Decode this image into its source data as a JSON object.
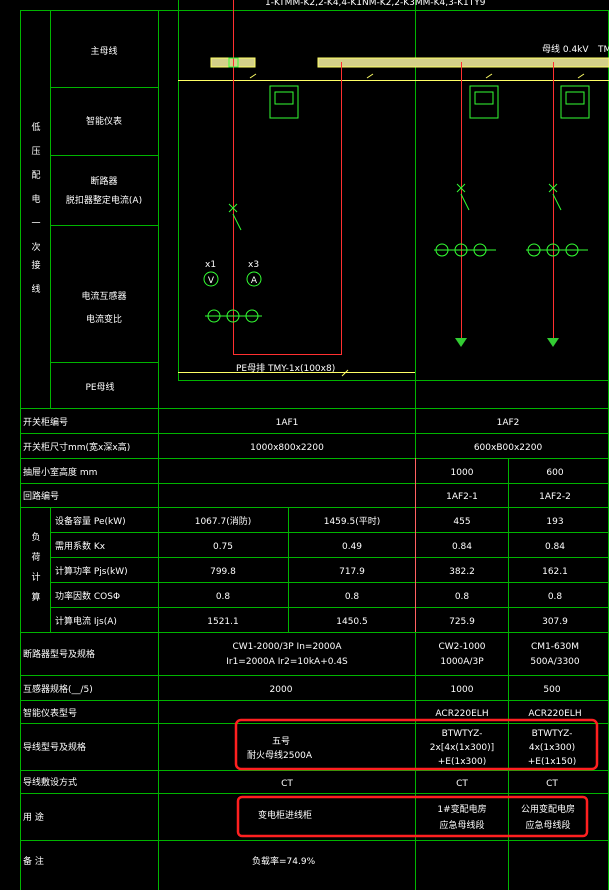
{
  "title_top": "1-KTMM-K2,2-K4,4-K1NM-K2,2-K3MM-K4,3-K1TY9",
  "bus_label": "母线 0.4kV",
  "bus_label_right": "TM",
  "left_headings": {
    "main_section_chars": [
      "低",
      "压",
      "配",
      "电",
      "一",
      "次",
      "接",
      "线"
    ],
    "main_busbar": "主母线",
    "smart_meter": "智能仪表",
    "breaker_line1": "断路器",
    "breaker_line2": "脱扣器整定电流(A)",
    "ct_line1": "电流互感器",
    "ct_line2": "电流变比",
    "pe_busbar": "PE母线"
  },
  "meters": {
    "v_label": "x1",
    "v_symbol": "V",
    "a_label": "x3",
    "a_symbol": "A"
  },
  "pe_bus_label": "PE母排 TMY-1x(100x8)",
  "table": {
    "row_labels": {
      "cabinet_no": "开关柜编号",
      "cabinet_size": "开关柜尺寸mm(宽x深x高)",
      "drawer_size": "抽屉小室高度 mm",
      "circuit_no": "回路编号",
      "calc_title": [
        "负",
        "荷",
        "计",
        "算"
      ],
      "pe": "设备容量 Pe(kW)",
      "kx": "需用系数 Kx",
      "pjs": "计算功率 Pjs(kW)",
      "cos": "功率因数 COSΦ",
      "ijs": "计算电流 Ijs(A)",
      "breaker": "断路器型号及规格",
      "ct": "互感器规格(__/5)",
      "meter_type": "智能仪表型号",
      "cable": "导线型号及规格",
      "laying": "导线敷设方式",
      "usage": "用 途",
      "remarks": "备 注"
    },
    "af1": {
      "cabinet_no": "1AF1",
      "cabinet_size": "1000x800x2200",
      "pe": [
        "1067.7(消防)",
        "1459.5(平时)"
      ],
      "kx": [
        "0.75",
        "0.49"
      ],
      "pjs": [
        "799.8",
        "717.9"
      ],
      "cos": [
        "0.8",
        "0.8"
      ],
      "ijs": [
        "1521.1",
        "1450.5"
      ],
      "breaker_l1": "CW1-2000/3P  In=2000A",
      "breaker_l2": "Ir1=2000A  Ir2=10kA+0.4S",
      "ct": "2000",
      "cable_l1": "五号",
      "cable_l2": "耐火母线2500A",
      "laying": "CT",
      "usage": "变电柜进线柜",
      "remarks": "负载率=74.9%"
    },
    "af2": {
      "cabinet_no": "1AF2",
      "cabinet_size": "600xB00x2200",
      "drawer": [
        "1000",
        "600"
      ],
      "circuit": [
        "1AF2-1",
        "1AF2-2"
      ],
      "pe": [
        "455",
        "193"
      ],
      "kx": [
        "0.84",
        "0.84"
      ],
      "pjs": [
        "382.2",
        "162.1"
      ],
      "cos": [
        "0.8",
        "0.8"
      ],
      "ijs": [
        "725.9",
        "307.9"
      ],
      "breaker_a_l1": "CW2-1000",
      "breaker_a_l2": "1000A/3P",
      "breaker_b_l1": "CM1-630M",
      "breaker_b_l2": "500A/3300",
      "ct": [
        "1000",
        "500"
      ],
      "meter": [
        "ACR220ELH",
        "ACR220ELH"
      ],
      "cable_a": [
        "BTWTYZ-",
        "2x[4x(1x300)]",
        "+E(1x300)"
      ],
      "cable_b": [
        "BTWTYZ-",
        "4x(1x300)",
        "+E(1x150)"
      ],
      "laying": [
        "CT",
        "CT"
      ],
      "usage_a": [
        "1#变配电房",
        "应急母线段"
      ],
      "usage_b": [
        "公用变配电房",
        "应急母线段"
      ]
    }
  },
  "colors": {
    "grid_green": "#00cc00",
    "bright_green": "#33ff33",
    "busbar_yellow": "#ffff66",
    "busbar_fill": "#d4d08a",
    "feeder_red": "#ff3030",
    "highlight_red": "#ff2020",
    "pink_line": "#ff6060"
  }
}
